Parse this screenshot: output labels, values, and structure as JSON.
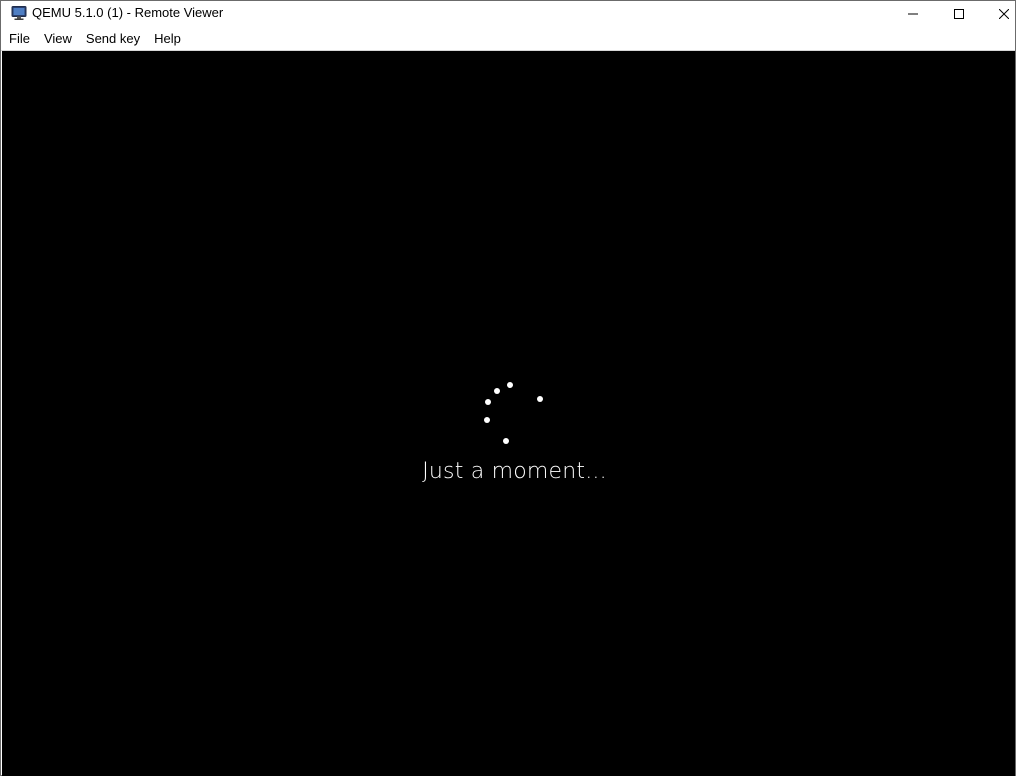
{
  "window": {
    "title": "QEMU 5.1.0 (1) - Remote Viewer",
    "icon": "monitor-icon",
    "controls": [
      "minimize-icon",
      "maximize-icon",
      "close-icon"
    ]
  },
  "menu": {
    "items": [
      {
        "label": "File"
      },
      {
        "label": "View"
      },
      {
        "label": "Send key"
      },
      {
        "label": "Help"
      }
    ]
  },
  "guest": {
    "status_text": "Just a moment...",
    "background": "#000000",
    "spinner_color": "#ffffff"
  }
}
